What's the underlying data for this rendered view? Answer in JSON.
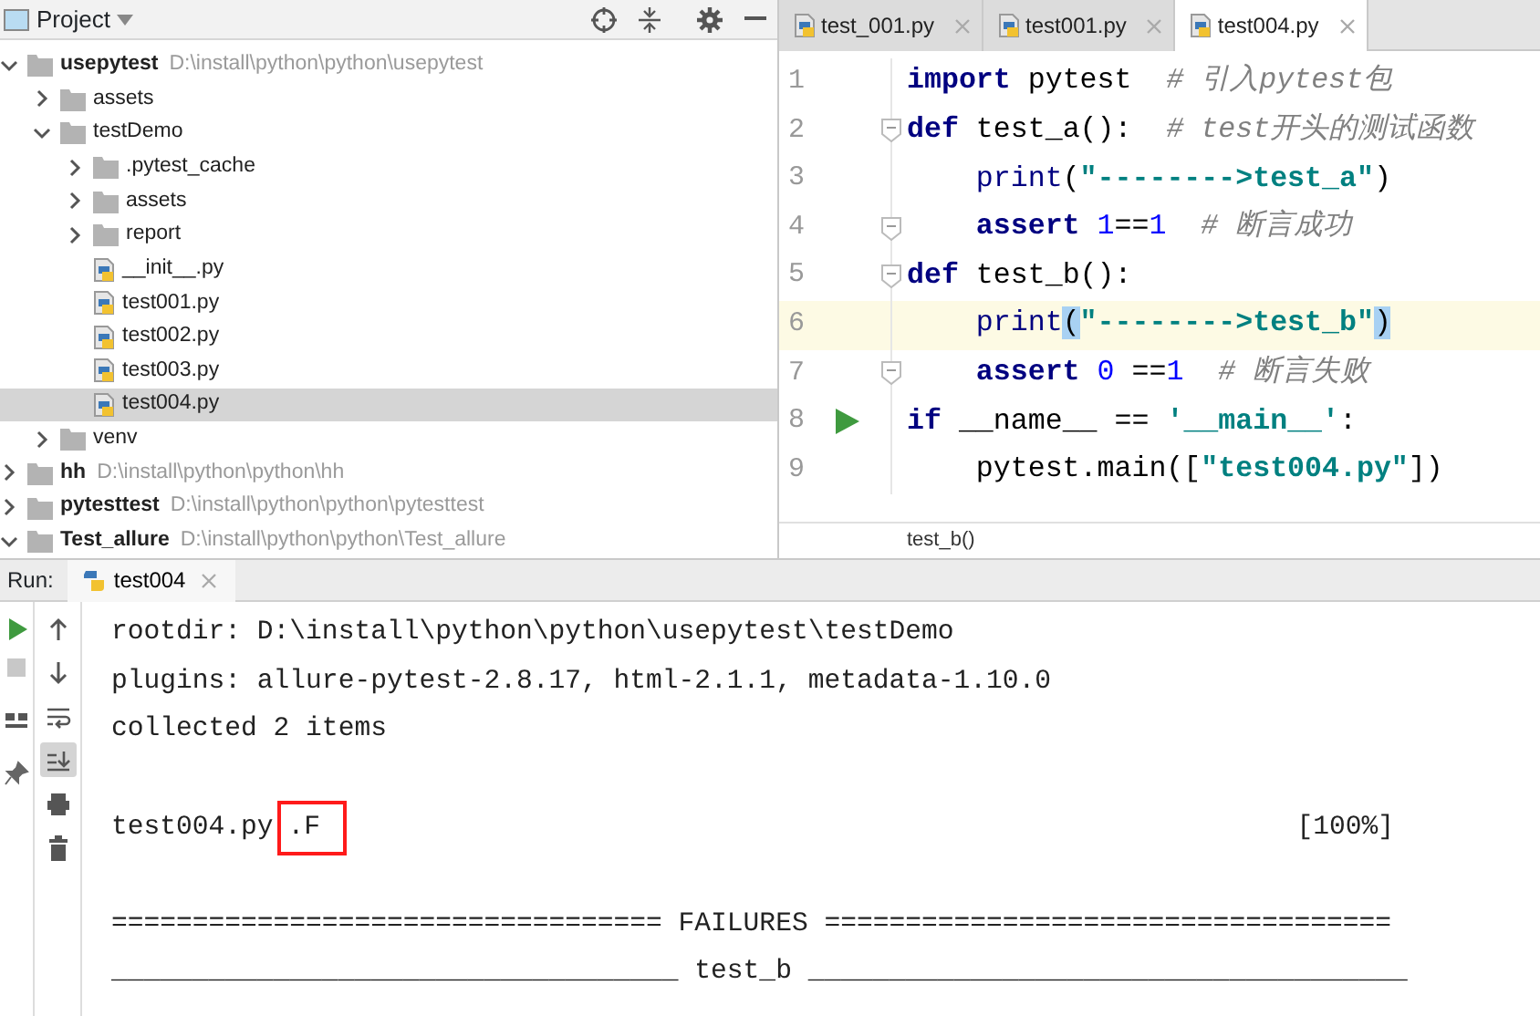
{
  "project_panel": {
    "title": "Project",
    "tree": [
      {
        "name": "usepytest",
        "path": "D:\\install\\python\\python\\usepytest",
        "kind": "module",
        "expanded": true,
        "selected": false,
        "children": [
          {
            "name": "assets",
            "kind": "folder",
            "expanded": false,
            "selected": false
          },
          {
            "name": "testDemo",
            "kind": "folder",
            "expanded": true,
            "selected": false,
            "children": [
              {
                "name": ".pytest_cache",
                "kind": "folder",
                "expanded": false,
                "selected": false
              },
              {
                "name": "assets",
                "kind": "folder",
                "expanded": false,
                "selected": false
              },
              {
                "name": "report",
                "kind": "folder",
                "expanded": false,
                "selected": false
              },
              {
                "name": "__init__.py",
                "kind": "file",
                "selected": false
              },
              {
                "name": "test001.py",
                "kind": "file",
                "selected": false
              },
              {
                "name": "test002.py",
                "kind": "file",
                "selected": false
              },
              {
                "name": "test003.py",
                "kind": "file",
                "selected": false
              },
              {
                "name": "test004.py",
                "kind": "file",
                "selected": true
              }
            ]
          },
          {
            "name": "venv",
            "kind": "folder",
            "expanded": false,
            "selected": false
          }
        ]
      },
      {
        "name": "hh",
        "path": "D:\\install\\python\\python\\hh",
        "kind": "module",
        "expanded": false,
        "selected": false
      },
      {
        "name": "pytesttest",
        "path": "D:\\install\\python\\python\\pytesttest",
        "kind": "module",
        "expanded": false,
        "selected": false
      },
      {
        "name": "Test_allure",
        "path": "D:\\install\\python\\python\\Test_allure",
        "kind": "module",
        "expanded": true,
        "selected": false
      }
    ]
  },
  "editor": {
    "tabs": [
      {
        "label": "test_001.py",
        "selected": false
      },
      {
        "label": "test001.py",
        "selected": false
      },
      {
        "label": "test004.py",
        "selected": true
      }
    ],
    "lines": [
      {
        "number": "1",
        "fold": false,
        "run": false,
        "current": false,
        "tokens": [
          {
            "kind": "keyword",
            "text": "import"
          },
          {
            "kind": "plain",
            "text": " pytest  "
          },
          {
            "kind": "comment",
            "text": "# 引入pytest包"
          }
        ]
      },
      {
        "number": "2",
        "fold": true,
        "run": false,
        "current": false,
        "tokens": [
          {
            "kind": "keyword",
            "text": "def"
          },
          {
            "kind": "plain",
            "text": " test_a():  "
          },
          {
            "kind": "comment",
            "text": "# test开头的测试函数"
          }
        ]
      },
      {
        "number": "3",
        "fold": false,
        "run": false,
        "current": false,
        "indented": true,
        "tokens": [
          {
            "kind": "builtin",
            "text": "print"
          },
          {
            "kind": "plain",
            "text": "("
          },
          {
            "kind": "string",
            "text": "\"-------->test_a\""
          },
          {
            "kind": "plain",
            "text": ")"
          }
        ]
      },
      {
        "number": "4",
        "fold": true,
        "run": false,
        "current": false,
        "indented": true,
        "tokens": [
          {
            "kind": "keyword",
            "text": "assert"
          },
          {
            "kind": "number",
            "text": " 1"
          },
          {
            "kind": "plain",
            "text": "=="
          },
          {
            "kind": "number",
            "text": "1"
          },
          {
            "kind": "comment",
            "text": "  # 断言成功"
          }
        ]
      },
      {
        "number": "5",
        "fold": true,
        "run": false,
        "current": false,
        "tokens": [
          {
            "kind": "keyword",
            "text": "def"
          },
          {
            "kind": "plain",
            "text": " test_b():"
          }
        ]
      },
      {
        "number": "6",
        "fold": false,
        "run": false,
        "current": true,
        "indented": true,
        "tokens": [
          {
            "kind": "builtin",
            "text": "print"
          },
          {
            "kind": "brace",
            "text": "("
          },
          {
            "kind": "string",
            "text": "\"-------->test_b\""
          },
          {
            "kind": "brace",
            "text": ")"
          }
        ]
      },
      {
        "number": "7",
        "fold": true,
        "run": false,
        "current": false,
        "indented": true,
        "tokens": [
          {
            "kind": "keyword",
            "text": "assert"
          },
          {
            "kind": "number",
            "text": " 0"
          },
          {
            "kind": "plain",
            "text": " =="
          },
          {
            "kind": "number",
            "text": "1"
          },
          {
            "kind": "comment",
            "text": "  # 断言失败"
          }
        ]
      },
      {
        "number": "8",
        "fold": false,
        "run": true,
        "current": false,
        "tokens": [
          {
            "kind": "keyword",
            "text": "if"
          },
          {
            "kind": "plain",
            "text": " __name__ == "
          },
          {
            "kind": "string",
            "text": "'__main__'"
          },
          {
            "kind": "plain",
            "text": ":"
          }
        ]
      },
      {
        "number": "9",
        "fold": false,
        "run": false,
        "current": false,
        "indented": true,
        "tokens": [
          {
            "kind": "plain",
            "text": "pytest.main(["
          },
          {
            "kind": "string",
            "text": "\"test004.py\""
          },
          {
            "kind": "plain",
            "text": "])"
          }
        ]
      }
    ],
    "breadcrumb": "test_b()"
  },
  "run_panel": {
    "label": "Run:",
    "tabs": [
      {
        "label": "test004",
        "selected": true
      }
    ],
    "console": [
      {
        "kind": "text",
        "text": "rootdir: D:\\install\\python\\python\\usepytest\\testDemo"
      },
      {
        "kind": "text",
        "text": "plugins: allure-pytest-2.8.17, html-2.1.1, metadata-1.10.0"
      },
      {
        "kind": "text",
        "text": "collected 2 items"
      },
      {
        "kind": "blank"
      },
      {
        "kind": "progress",
        "text": "test004.py",
        "result": ".F",
        "percent": "[100%]"
      },
      {
        "kind": "blank"
      },
      {
        "kind": "text",
        "text": "================================== FAILURES ==================================="
      },
      {
        "kind": "text",
        "text": "___________________________________ test_b _____________________________________"
      }
    ]
  }
}
